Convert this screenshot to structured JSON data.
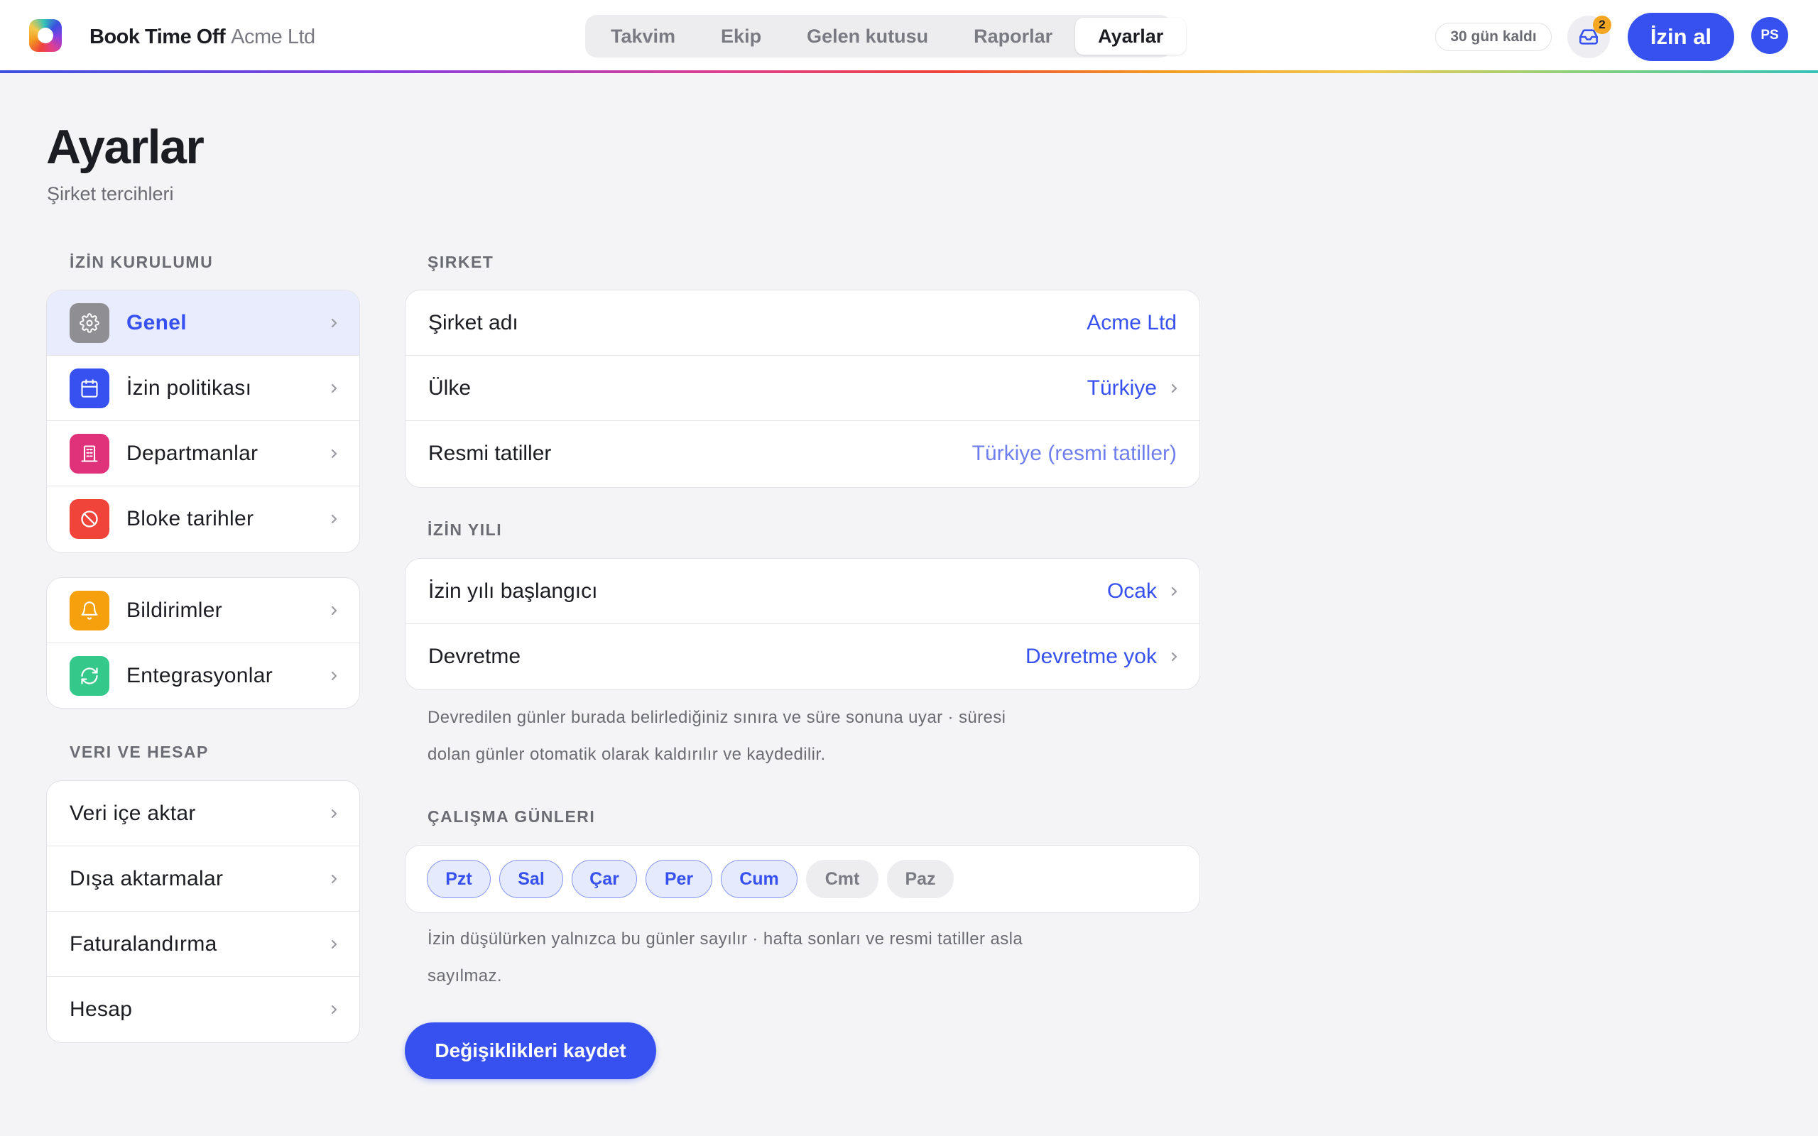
{
  "app": {
    "name": "Book Time Off",
    "org": "Acme Ltd"
  },
  "nav": {
    "tabs": [
      {
        "label": "Takvim",
        "active": false
      },
      {
        "label": "Ekip",
        "active": false
      },
      {
        "label": "Gelen kutusu",
        "active": false
      },
      {
        "label": "Raporlar",
        "active": false
      },
      {
        "label": "Ayarlar",
        "active": true
      }
    ]
  },
  "header": {
    "trial_label": "30 gün kaldı",
    "inbox_count": "2",
    "cta_label": "İzin al",
    "avatar_initials": "PS"
  },
  "page": {
    "title": "Ayarlar",
    "subtitle": "Şirket tercihleri"
  },
  "sidebar": {
    "section1_title": "İZİN KURULUMU",
    "group1": [
      {
        "label": "Genel",
        "icon": "gear-icon",
        "color": "#8e8e93",
        "active": true
      },
      {
        "label": "İzin politikası",
        "icon": "calendar-icon",
        "color": "#3651f0",
        "active": false
      },
      {
        "label": "Departmanlar",
        "icon": "building-icon",
        "color": "#e0317b",
        "active": false
      },
      {
        "label": "Bloke tarihler",
        "icon": "block-icon",
        "color": "#f0433a",
        "active": false
      }
    ],
    "group2": [
      {
        "label": "Bildirimler",
        "icon": "bell-icon",
        "color": "#f5a00c"
      },
      {
        "label": "Entegrasyonlar",
        "icon": "sync-icon",
        "color": "#34c98a"
      }
    ],
    "section2_title": "VERI VE HESAP",
    "group3": [
      {
        "label": "Veri içe aktar"
      },
      {
        "label": "Dışa aktarmalar"
      },
      {
        "label": "Faturalandırma"
      },
      {
        "label": "Hesap"
      }
    ]
  },
  "company": {
    "section_title": "ŞIRKET",
    "name_label": "Şirket adı",
    "name_value": "Acme Ltd",
    "country_label": "Ülke",
    "country_value": "Türkiye",
    "holidays_label": "Resmi tatiller",
    "holidays_value": "Türkiye (resmi tatiller)"
  },
  "leave_year": {
    "section_title": "İZİN YILI",
    "start_label": "İzin yılı başlangıcı",
    "start_value": "Ocak",
    "carryover_label": "Devretme",
    "carryover_value": "Devretme yok",
    "note_line1": "Devredilen günler burada belirlediğiniz sınıra ve süre sonuna uyar · süresi",
    "note_line2": "dolan günler otomatik olarak kaldırılır ve kaydedilir."
  },
  "work_days": {
    "section_title": "ÇALIŞMA GÜNLERI",
    "days": [
      {
        "label": "Pzt",
        "on": true
      },
      {
        "label": "Sal",
        "on": true
      },
      {
        "label": "Çar",
        "on": true
      },
      {
        "label": "Per",
        "on": true
      },
      {
        "label": "Cum",
        "on": true
      },
      {
        "label": "Cmt",
        "on": false
      },
      {
        "label": "Paz",
        "on": false
      }
    ],
    "note_line1": "İzin düşülürken yalnızca bu günler sayılır · hafta sonları ve resmi tatiller asla",
    "note_line2": "sayılmaz."
  },
  "save_label": "Değişiklikleri kaydet"
}
